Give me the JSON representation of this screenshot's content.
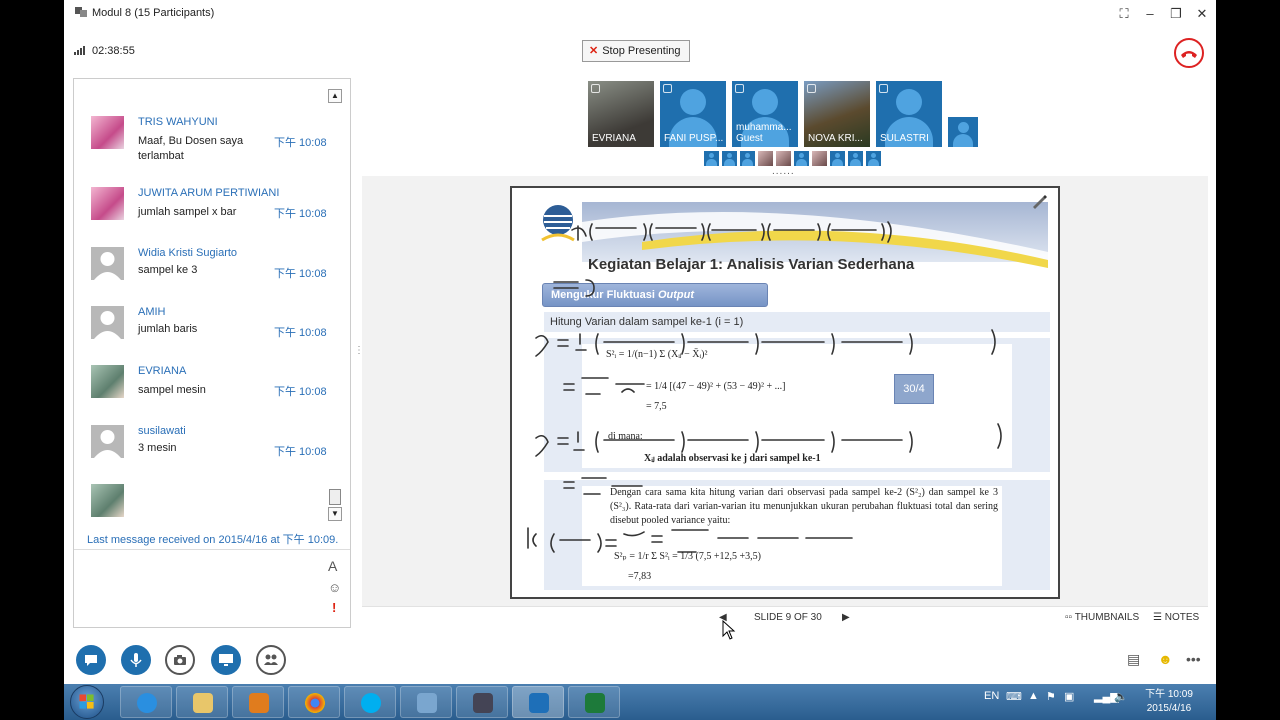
{
  "window": {
    "title": "Modul 8 (15 Participants)",
    "elapsed": "02:38:55",
    "stop_presenting": "Stop Presenting"
  },
  "chat": {
    "messages": [
      {
        "name": "TRIS WAHYUNI",
        "text": "Maaf, Bu Dosen saya terlambat",
        "time": "下午 10:08",
        "avatar": "pink-photo"
      },
      {
        "name": "JUWITA ARUM PERTIWIANI",
        "text": "jumlah sampel x bar",
        "time": "下午 10:08",
        "avatar": "pink-photo"
      },
      {
        "name": "Widia Kristi Sugiarto",
        "text": "sampel ke 3",
        "time": "下午 10:08",
        "avatar": "generic-person"
      },
      {
        "name": "AMIH",
        "text": "jumlah baris",
        "time": "下午 10:08",
        "avatar": "generic-person"
      },
      {
        "name": "EVRIANA",
        "text": "sampel mesin",
        "time": "下午 10:08",
        "avatar": "photo"
      },
      {
        "name": "susilawati",
        "text": "3 mesin",
        "time": "下午 10:08",
        "avatar": "generic-person"
      }
    ],
    "last_received": "Last message received on 2015/4/16 at 下午 10:09.",
    "font_icon": "A",
    "emoji_icon": "☺",
    "priority_icon": "!"
  },
  "participants": {
    "tiles": [
      {
        "label": "EVRIANA",
        "kind": "video"
      },
      {
        "label": "FANI PUSP...",
        "kind": "avatar"
      },
      {
        "label": "muhamma...",
        "sublabel": "Guest",
        "kind": "avatar"
      },
      {
        "label": "NOVA KRI...",
        "kind": "video"
      },
      {
        "label": "SULASTRI",
        "kind": "avatar"
      }
    ],
    "more": "......"
  },
  "slide": {
    "title": "Kegiatan Belajar 1: Analisis Varian Sederhana",
    "subhead": "Mengukur Fluktuasi",
    "subhead_italic": "Output",
    "line": "Hitung Varian dalam sampel ke-1 (i = 1)",
    "formula1": "S²ᵢ = 1/(n−1) Σ (Xᵢⱼ − X̄ᵢ)²",
    "formula2": "= 1/4 [(47 − 49)² + (53 − 49)² + ...]",
    "formula3": "= 7,5",
    "where": "di mana:",
    "where_def": "Xᵢⱼ adalah observasi ke j dari sampel ke-1",
    "para": "Dengan cara sama kita hitung varian dari observasi pada sampel ke-2 (S²₂) dan sampel ke 3 (S²₃). Rata-rata dari varian-varian itu menunjukkan ukuran perubahan fluktuasi total dan sering disebut pooled variance yaitu:",
    "pooled1": "S²ₚ = 1/r Σ S²ᵢ = 1/3 (7,5 +12,5 +3,5)",
    "pooled2": "=7,83",
    "page_badge": "30/4"
  },
  "slide_nav": {
    "counter": "SLIDE 9 OF 30",
    "thumbnails": "THUMBNAILS",
    "notes": "NOTES"
  },
  "taskbar": {
    "lang": "EN",
    "time": "下午 10:09",
    "date": "2015/4/16"
  }
}
